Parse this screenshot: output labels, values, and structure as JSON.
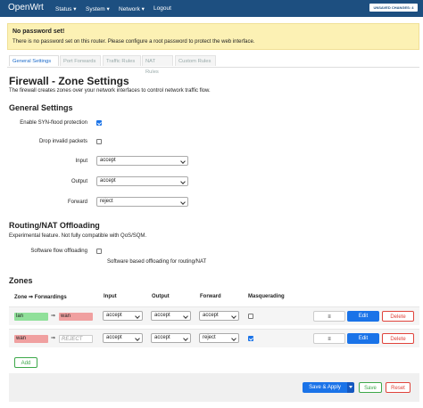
{
  "nav": {
    "brand": "OpenWrt",
    "items": [
      "Status ▾",
      "System ▾",
      "Network ▾",
      "Logout"
    ],
    "unsaved": "UNSAVED CHANGES: 4"
  },
  "alert": {
    "title": "No password set!",
    "message": "There is no password set on this router. Please configure a root password to protect the web interface."
  },
  "tabs": [
    "General Settings",
    "Port Forwards",
    "Traffic Rules",
    "NAT Rules",
    "Custom Rules"
  ],
  "page": {
    "title": "Firewall - Zone Settings",
    "description": "The firewall creates zones over your network interfaces to control network traffic flow."
  },
  "general": {
    "heading": "General Settings",
    "syn_label": "Enable SYN-flood protection",
    "syn_checked": true,
    "drop_label": "Drop invalid packets",
    "drop_checked": false,
    "input_label": "Input",
    "input_value": "accept",
    "output_label": "Output",
    "output_value": "accept",
    "forward_label": "Forward",
    "forward_value": "reject"
  },
  "offload": {
    "heading": "Routing/NAT Offloading",
    "note": "Experimental feature. Not fully compatible with QoS/SQM.",
    "sw_label": "Software flow offloading",
    "sw_checked": false,
    "sw_help": "Software based offloading for routing/NAT"
  },
  "zones": {
    "heading": "Zones",
    "headers": {
      "zone": "Zone ⇒ Forwardings",
      "input": "Input",
      "output": "Output",
      "forward": "Forward",
      "masq": "Masquerading"
    },
    "rows": [
      {
        "name": "lan",
        "arrow": "⇒",
        "target": "wan",
        "input": "accept",
        "output": "accept",
        "forward": "accept",
        "masq": false
      },
      {
        "name": "wan",
        "arrow": "⇒",
        "target": "REJECT",
        "input": "accept",
        "output": "accept",
        "forward": "reject",
        "masq": true
      }
    ],
    "drag_label": "≡",
    "edit_label": "Edit",
    "delete_label": "Delete",
    "add_label": "Add"
  },
  "footer": {
    "save_apply": "Save & Apply",
    "save": "Save",
    "reset": "Reset"
  },
  "colors": {
    "topbar": "#1d4f80",
    "accent": "#1b6ac9",
    "lan": "#90e09a",
    "wan": "#f0a0a0",
    "delete": "#e0443c",
    "save": "#3da84a"
  }
}
